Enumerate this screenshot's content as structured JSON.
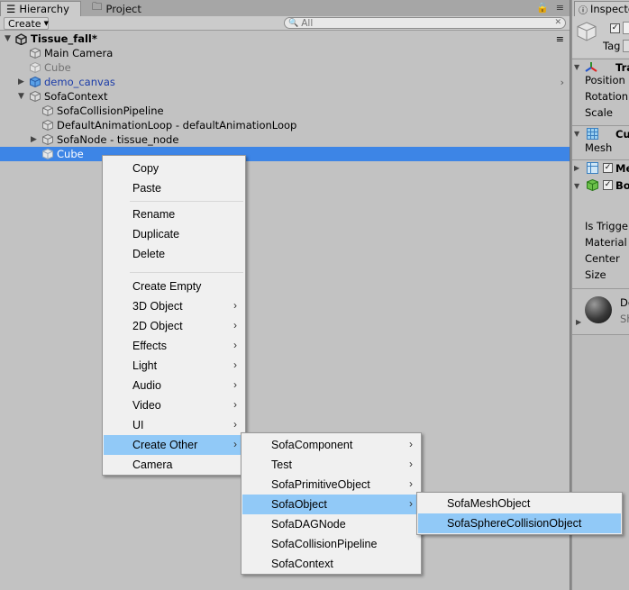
{
  "hierarchy": {
    "tab_label": "Hierarchy",
    "project_tab_label": "Project",
    "create_label": "Create",
    "search_placeholder": "All",
    "scene_name": "Tissue_fall*",
    "rows": [
      {
        "label": "Main Camera"
      },
      {
        "label": "Cube"
      },
      {
        "label": "demo_canvas"
      },
      {
        "label": "SofaContext"
      },
      {
        "label": "SofaCollisionPipeline"
      },
      {
        "label": "DefaultAnimationLoop  -  defaultAnimationLoop"
      },
      {
        "label": "SofaNode - tissue_node"
      },
      {
        "label": "Cube"
      }
    ]
  },
  "inspector": {
    "tab_label": "Inspector",
    "tag_label": "Tag",
    "transform_label": "Transform",
    "position_label": "Position",
    "rotation_label": "Rotation",
    "scale_label": "Scale",
    "mesh_filter_label": "Cube",
    "mesh_label": "Mesh",
    "mesh_renderer_label": "Mesh Renderer",
    "box_collider_label": "Box Collider",
    "is_trigger_label": "Is Trigger",
    "material_label": "Material",
    "center_label": "Center",
    "size_label": "Size",
    "material_name": "Default-Material",
    "shader_label": "Shader"
  },
  "context_menu": {
    "items": [
      {
        "label": "Copy"
      },
      {
        "label": "Paste"
      },
      {
        "label": "Rename"
      },
      {
        "label": "Duplicate"
      },
      {
        "label": "Delete"
      },
      {
        "label": "Create Empty"
      },
      {
        "label": "3D Object"
      },
      {
        "label": "2D Object"
      },
      {
        "label": "Effects"
      },
      {
        "label": "Light"
      },
      {
        "label": "Audio"
      },
      {
        "label": "Video"
      },
      {
        "label": "UI"
      },
      {
        "label": "Create Other"
      },
      {
        "label": "Camera"
      }
    ]
  },
  "create_other_menu": {
    "items": [
      {
        "label": "SofaComponent"
      },
      {
        "label": "Test"
      },
      {
        "label": "SofaPrimitiveObject"
      },
      {
        "label": "SofaObject"
      },
      {
        "label": "SofaDAGNode"
      },
      {
        "label": "SofaCollisionPipeline"
      },
      {
        "label": "SofaContext"
      }
    ]
  },
  "sofa_object_menu": {
    "items": [
      {
        "label": "SofaMeshObject"
      },
      {
        "label": "SofaSphereCollisionObject"
      }
    ]
  },
  "colors": {
    "selection": "#3d85e6",
    "menu_highlight": "#91c9f7",
    "panel_bg": "#c2c2c2",
    "prefab_text": "#1a3ba8"
  }
}
